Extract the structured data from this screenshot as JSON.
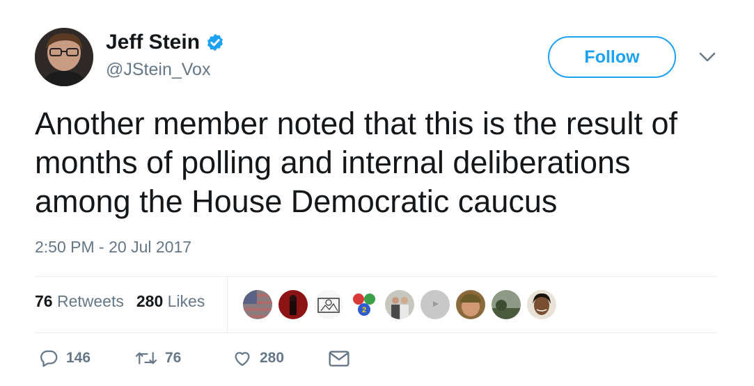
{
  "user": {
    "display_name": "Jeff Stein",
    "handle": "@JStein_Vox",
    "verified": true
  },
  "follow_button": {
    "label": "Follow"
  },
  "tweet": {
    "text": "Another member noted that this is the result of months of polling and internal deliberations among the House Democratic caucus",
    "timestamp": "2:50 PM - 20 Jul 2017"
  },
  "stats": {
    "retweets_count": "76",
    "retweets_label": "Retweets",
    "likes_count": "280",
    "likes_label": "Likes"
  },
  "likers": [
    {
      "icon": "flag-avatar"
    },
    {
      "icon": "red-room-avatar"
    },
    {
      "icon": "sketch-avatar"
    },
    {
      "icon": "gears-logo-avatar"
    },
    {
      "icon": "two-people-avatar"
    },
    {
      "icon": "grey-avatar"
    },
    {
      "icon": "man-cap-avatar"
    },
    {
      "icon": "landscape-avatar"
    },
    {
      "icon": "woman-avatar"
    }
  ],
  "actions": {
    "reply_count": "146",
    "retweet_count": "76",
    "like_count": "280"
  },
  "colors": {
    "accent": "#1da1f2",
    "muted": "#657786",
    "text": "#14171a",
    "border": "#e6ecf0"
  }
}
